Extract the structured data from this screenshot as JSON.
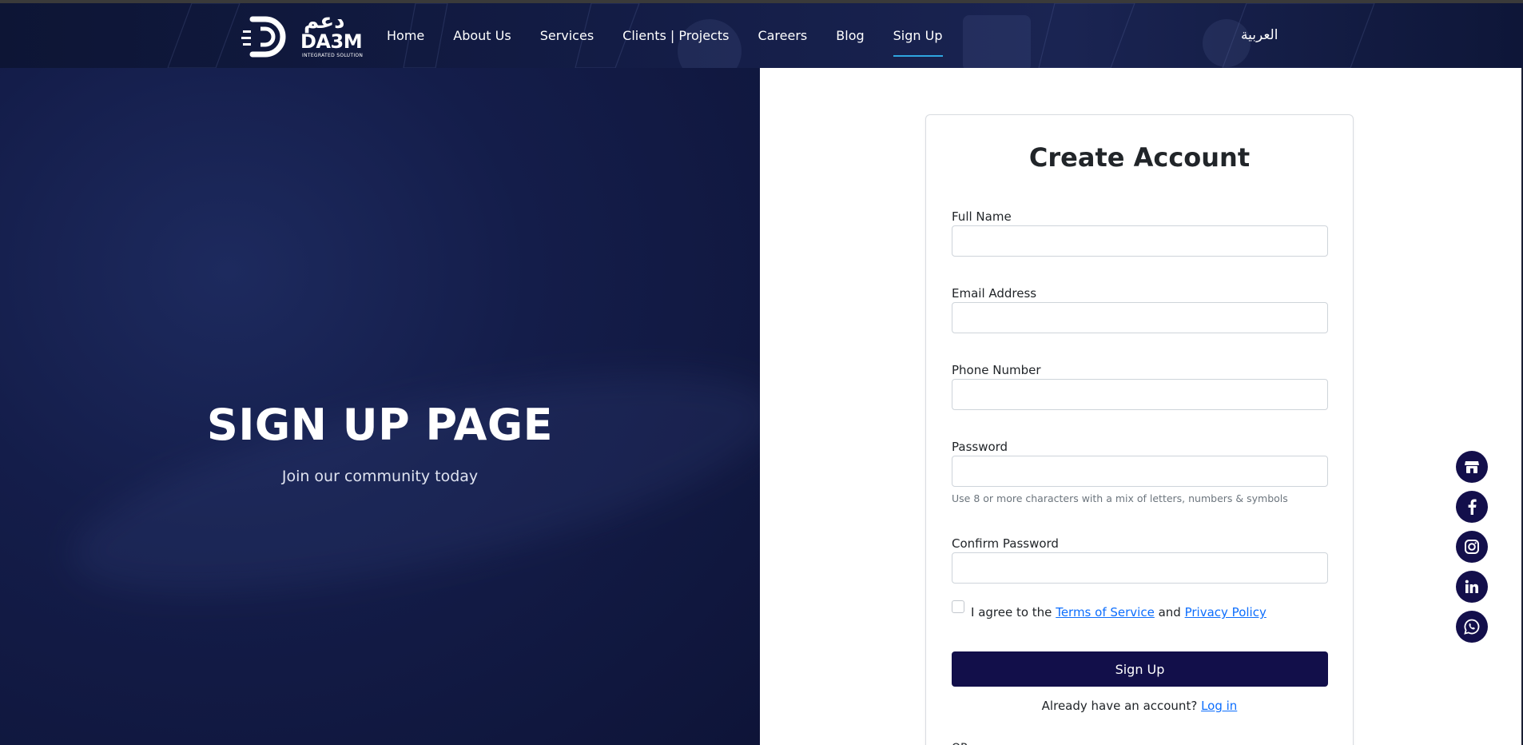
{
  "nav": {
    "logo": {
      "word": "DA3M",
      "arabic": "دعم",
      "tagline": "INTEGRATED SOLUTION"
    },
    "links": [
      {
        "label": "Home"
      },
      {
        "label": "About Us"
      },
      {
        "label": "Services"
      },
      {
        "label": "Clients | Projects"
      },
      {
        "label": "Careers"
      },
      {
        "label": "Blog"
      },
      {
        "label": "Sign Up",
        "active": true
      }
    ],
    "language": "العربية"
  },
  "hero": {
    "title": "SIGN UP PAGE",
    "subtitle": "Join our community today"
  },
  "form": {
    "title": "Create Account",
    "full_name": {
      "label": "Full Name",
      "value": ""
    },
    "email": {
      "label": "Email Address",
      "value": ""
    },
    "phone": {
      "label": "Phone Number",
      "value": ""
    },
    "password": {
      "label": "Password",
      "value": "",
      "hint": "Use 8 or more characters with a mix of letters, numbers & symbols"
    },
    "confirm_password": {
      "label": "Confirm Password",
      "value": ""
    },
    "agree": {
      "checked": false,
      "prefix": "I agree to the",
      "terms": "Terms of Service",
      "and": "and",
      "privacy": "Privacy Policy"
    },
    "submit": "Sign Up",
    "login_prompt": "Already have an account?",
    "login_link": "Log in",
    "or": "OR"
  },
  "social": [
    {
      "icon": "store-icon"
    },
    {
      "icon": "facebook-icon"
    },
    {
      "icon": "instagram-icon"
    },
    {
      "icon": "linkedin-icon"
    },
    {
      "icon": "whatsapp-icon"
    }
  ],
  "colors": {
    "primary_button": "#120f4a",
    "link": "#0d6efd",
    "active_underline": "#2fa6e0",
    "social_bg": "#130f4b"
  }
}
